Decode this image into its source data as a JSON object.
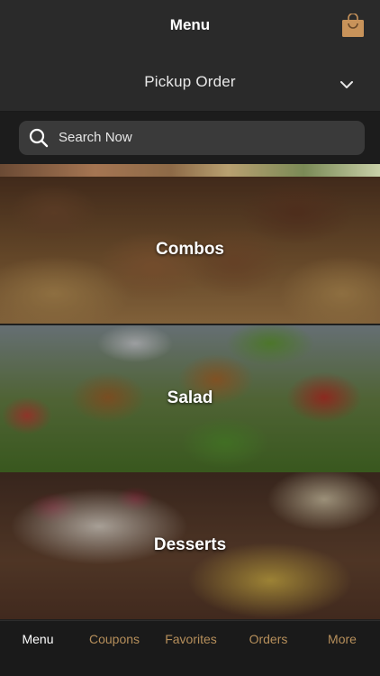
{
  "header": {
    "title": "Menu",
    "bag_icon": "shopping-bag-icon",
    "accent": "#c8935a"
  },
  "order": {
    "label": "Pickup Order",
    "chevron_icon": "chevron-down-icon"
  },
  "search": {
    "placeholder": "Search Now",
    "icon": "search-icon"
  },
  "categories": [
    {
      "label": "Combos"
    },
    {
      "label": "Salad"
    },
    {
      "label": "Desserts"
    }
  ],
  "tabs": [
    {
      "label": "Menu",
      "active": true
    },
    {
      "label": "Coupons",
      "active": false
    },
    {
      "label": "Favorites",
      "active": false
    },
    {
      "label": "Orders",
      "active": false
    },
    {
      "label": "More",
      "active": false
    }
  ],
  "colors": {
    "tab_active": "#ffffff",
    "tab_inactive": "#b68f5b",
    "background": "#1e1e1e"
  }
}
